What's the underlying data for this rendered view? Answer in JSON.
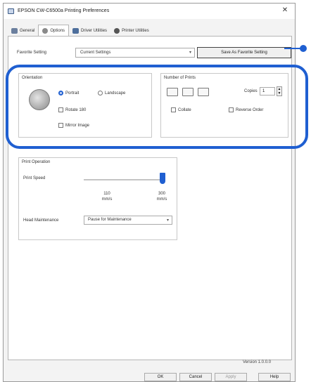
{
  "window": {
    "title": "EPSON CW-C6500a Printing Preferences",
    "close_glyph": "✕"
  },
  "tabs": [
    {
      "label": "General",
      "icon": "general-icon"
    },
    {
      "label": "Options",
      "icon": "options-icon"
    },
    {
      "label": "Driver Utilities",
      "icon": "driver-utilities-icon"
    },
    {
      "label": "Printer Utilities",
      "icon": "printer-utilities-icon"
    }
  ],
  "favorite": {
    "label": "Favorite Setting",
    "value": "Current Settings",
    "save_button": "Save As Favorite Setting"
  },
  "orientation": {
    "title": "Orientation",
    "options": [
      "Portrait",
      "Landscape"
    ],
    "selected": "Portrait",
    "rotate_180": "Rotate 180",
    "mirror_image": "Mirror Image"
  },
  "copies": {
    "title": "Number of Prints",
    "copies_label": "Copies",
    "copies_value": "1",
    "collate": "Collate",
    "reverse_order": "Reverse Order"
  },
  "print_speed": {
    "title": "Print Operation",
    "label": "Print Speed",
    "min_value": "110",
    "min_unit": "mm/s",
    "max_value": "300",
    "max_unit": "mm/s",
    "level": 1.0
  },
  "head_maintenance": {
    "label": "Head Maintenance",
    "value": "Pause for Maintenance"
  },
  "footer": {
    "version": "Version 1.0.0.0",
    "ok": "OK",
    "cancel": "Cancel",
    "apply": "Apply",
    "help": "Help"
  },
  "colors": {
    "accent": "#1f5fd1"
  }
}
